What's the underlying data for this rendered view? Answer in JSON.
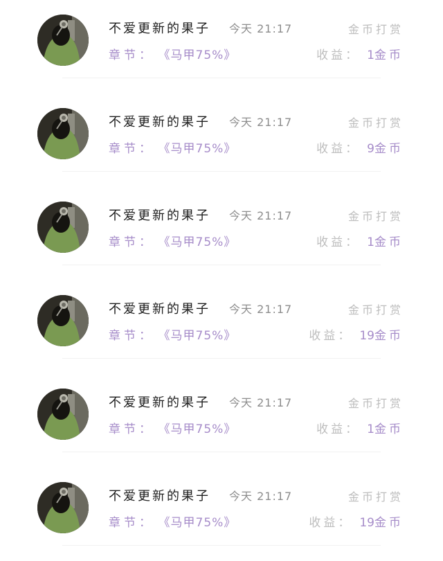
{
  "colors": {
    "accent": "#a68cc9",
    "name_text": "#1e1e1e",
    "muted": "#8c8c8c",
    "light_muted": "#bdbdbd",
    "divider": "#f1f1f1"
  },
  "records": [
    {
      "name": "不爱更新的果子",
      "time": "今天 21:17",
      "action": "金币打赏",
      "chapter_label": "章节：",
      "chapter": "《马甲75%》",
      "earn_label": "收益：",
      "earn_amount": "1",
      "earn_unit": "金币",
      "avatar_icon": "user-avatar"
    },
    {
      "name": "不爱更新的果子",
      "time": "今天 21:17",
      "action": "金币打赏",
      "chapter_label": "章节：",
      "chapter": "《马甲75%》",
      "earn_label": "收益：",
      "earn_amount": "9",
      "earn_unit": "金币",
      "avatar_icon": "user-avatar"
    },
    {
      "name": "不爱更新的果子",
      "time": "今天 21:17",
      "action": "金币打赏",
      "chapter_label": "章节：",
      "chapter": "《马甲75%》",
      "earn_label": "收益：",
      "earn_amount": "1",
      "earn_unit": "金币",
      "avatar_icon": "user-avatar"
    },
    {
      "name": "不爱更新的果子",
      "time": "今天 21:17",
      "action": "金币打赏",
      "chapter_label": "章节：",
      "chapter": "《马甲75%》",
      "earn_label": "收益：",
      "earn_amount": "19",
      "earn_unit": "金币",
      "avatar_icon": "user-avatar"
    },
    {
      "name": "不爱更新的果子",
      "time": "今天 21:17",
      "action": "金币打赏",
      "chapter_label": "章节：",
      "chapter": "《马甲75%》",
      "earn_label": "收益：",
      "earn_amount": "1",
      "earn_unit": "金币",
      "avatar_icon": "user-avatar"
    },
    {
      "name": "不爱更新的果子",
      "time": "今天 21:17",
      "action": "金币打赏",
      "chapter_label": "章节：",
      "chapter": "《马甲75%》",
      "earn_label": "收益：",
      "earn_amount": "19",
      "earn_unit": "金币",
      "avatar_icon": "user-avatar"
    }
  ]
}
